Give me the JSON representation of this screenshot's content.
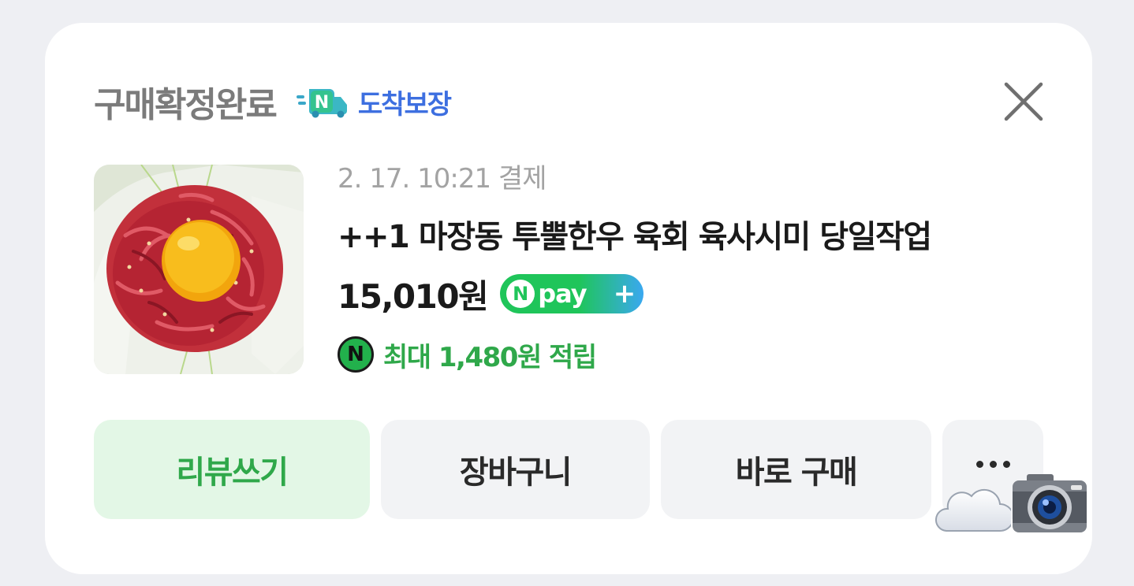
{
  "header": {
    "status_title": "구매확정완료",
    "badge_label": "도착보장",
    "badge_icon": "n-delivery-truck-icon",
    "close_icon": "close-icon"
  },
  "order": {
    "paid_at": "2. 17. 10:21 결제",
    "product_name": "++1 마장동 투뿔한우 육회 육사시미 당일작업",
    "price": "15,010원",
    "npay": {
      "n_letter": "N",
      "word": "pay",
      "plus": "+"
    },
    "reward": {
      "icon_letter": "N",
      "text": "최대 1,480원 적립"
    },
    "thumbnail_icon": "beef-tartare-image"
  },
  "actions": {
    "review": "리뷰쓰기",
    "cart": "장바구니",
    "buy_now": "바로 구매",
    "more_icon": "more-dots-icon"
  },
  "overlay": {
    "icons": [
      "cloud-icon",
      "camera-icon"
    ]
  },
  "colors": {
    "page_bg": "#eeeff3",
    "card_bg": "#ffffff",
    "status_gray": "#7b7b7b",
    "badge_blue": "#3d6fe0",
    "reward_green": "#2fa84a",
    "npay_green": "#1fc55a",
    "review_bg": "#e3f7e6",
    "button_bg": "#f2f3f5"
  }
}
